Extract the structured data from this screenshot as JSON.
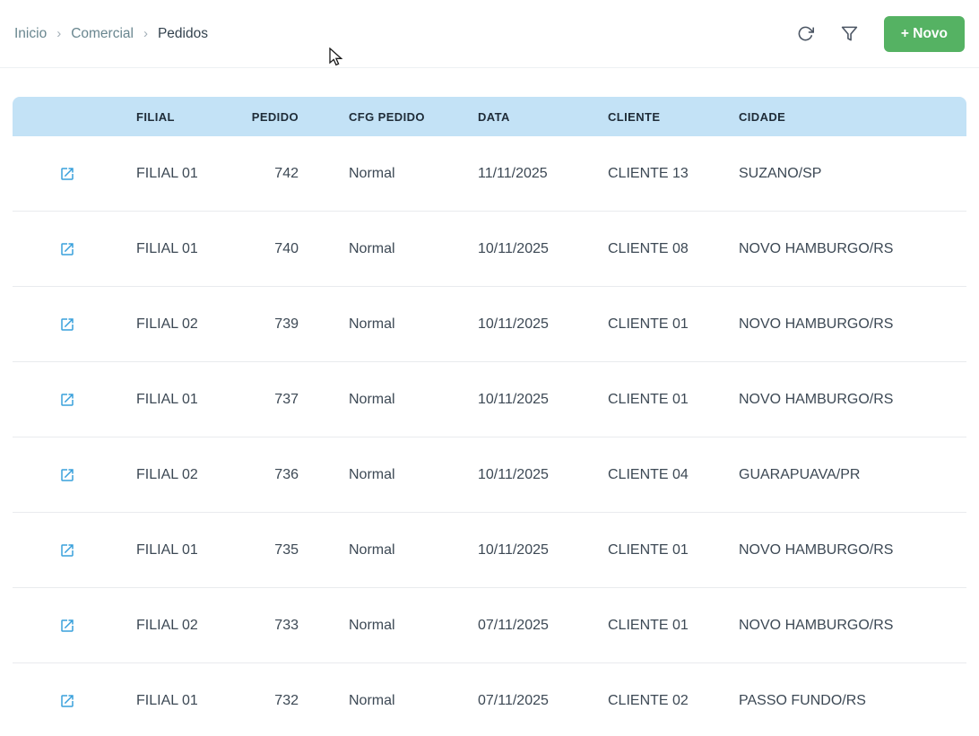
{
  "breadcrumb": {
    "items": [
      "Inicio",
      "Comercial",
      "Pedidos"
    ],
    "separator": "›"
  },
  "toolbar": {
    "new_button_label": "+ Novo"
  },
  "table": {
    "headers": {
      "actions": "",
      "filial": "FILIAL",
      "pedido": "PEDIDO",
      "cfg_pedido": "CFG PEDIDO",
      "data": "DATA",
      "cliente": "CLIENTE",
      "cidade": "CIDADE"
    },
    "rows": [
      {
        "filial": "FILIAL 01",
        "pedido": "742",
        "cfg_pedido": "Normal",
        "data": "11/11/2025",
        "cliente": "CLIENTE 13",
        "cidade": "SUZANO/SP"
      },
      {
        "filial": "FILIAL 01",
        "pedido": "740",
        "cfg_pedido": "Normal",
        "data": "10/11/2025",
        "cliente": "CLIENTE 08",
        "cidade": "NOVO HAMBURGO/RS"
      },
      {
        "filial": "FILIAL 02",
        "pedido": "739",
        "cfg_pedido": "Normal",
        "data": "10/11/2025",
        "cliente": "CLIENTE 01",
        "cidade": "NOVO HAMBURGO/RS"
      },
      {
        "filial": "FILIAL 01",
        "pedido": "737",
        "cfg_pedido": "Normal",
        "data": "10/11/2025",
        "cliente": "CLIENTE 01",
        "cidade": "NOVO HAMBURGO/RS"
      },
      {
        "filial": "FILIAL 02",
        "pedido": "736",
        "cfg_pedido": "Normal",
        "data": "10/11/2025",
        "cliente": "CLIENTE 04",
        "cidade": "GUARAPUAVA/PR"
      },
      {
        "filial": "FILIAL 01",
        "pedido": "735",
        "cfg_pedido": "Normal",
        "data": "10/11/2025",
        "cliente": "CLIENTE 01",
        "cidade": "NOVO HAMBURGO/RS"
      },
      {
        "filial": "FILIAL 02",
        "pedido": "733",
        "cfg_pedido": "Normal",
        "data": "07/11/2025",
        "cliente": "CLIENTE 01",
        "cidade": "NOVO HAMBURGO/RS"
      },
      {
        "filial": "FILIAL 01",
        "pedido": "732",
        "cfg_pedido": "Normal",
        "data": "07/11/2025",
        "cliente": "CLIENTE 02",
        "cidade": "PASSO FUNDO/RS"
      }
    ]
  },
  "colors": {
    "header_bg": "#c3e2f6",
    "accent_green": "#55b263",
    "link_blue": "#39a0dc"
  },
  "icons": {
    "refresh": "refresh-icon",
    "filter": "filter-icon",
    "row_open": "open-in-new-icon"
  }
}
